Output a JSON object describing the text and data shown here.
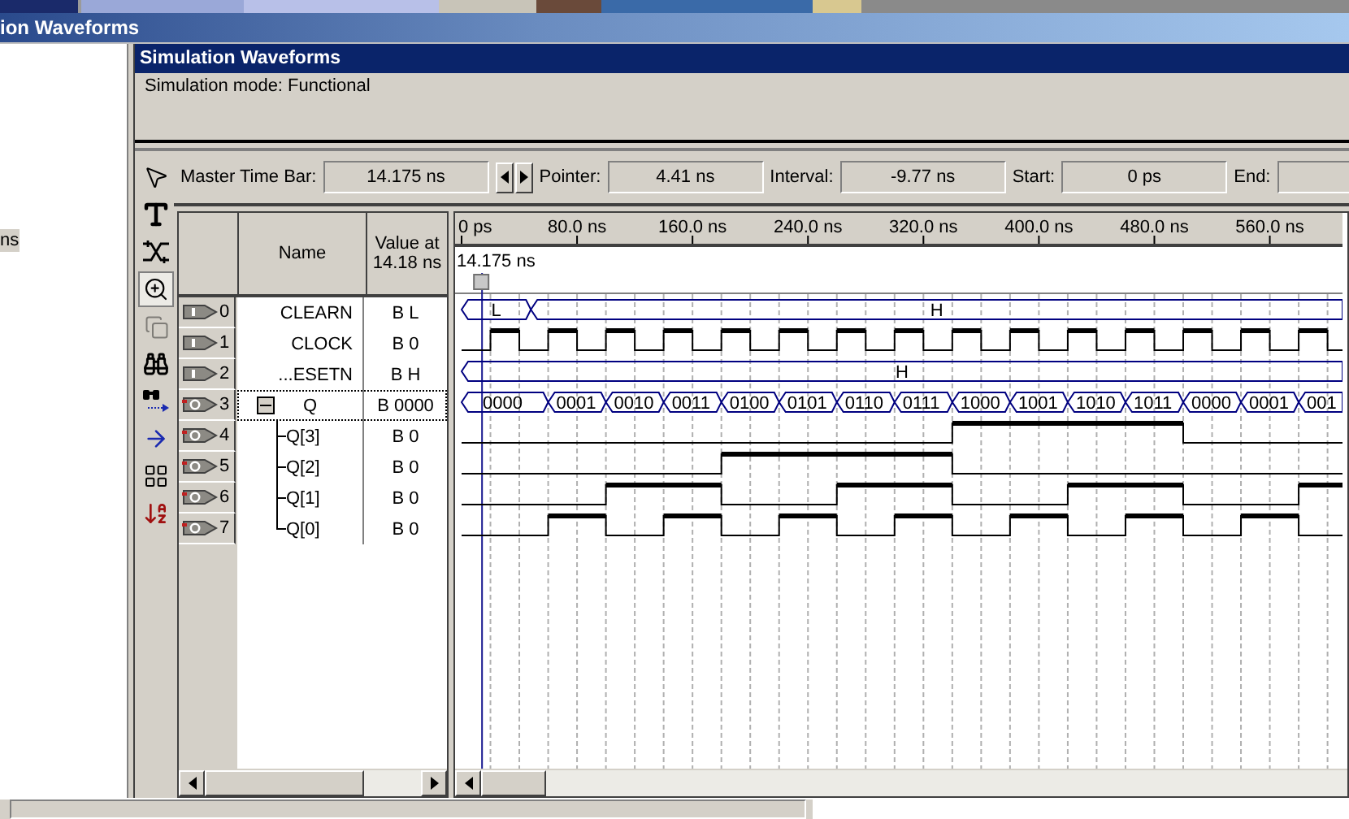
{
  "app_title": "ion Waveforms",
  "left_panel": {
    "fragment": "ns"
  },
  "window": {
    "title": "Simulation Waveforms",
    "mode": "Simulation mode: Functional"
  },
  "time_bar": {
    "master_label": "Master Time Bar:",
    "master_value": "14.175 ns",
    "pointer_label": "Pointer:",
    "pointer_value": "4.41 ns",
    "interval_label": "Interval:",
    "interval_value": "-9.77 ns",
    "start_label": "Start:",
    "start_value": "0 ps",
    "end_label": "End:"
  },
  "tools": [
    {
      "kind": "pointer",
      "selected": false,
      "disabled": false
    },
    {
      "kind": "text",
      "selected": false,
      "disabled": false
    },
    {
      "kind": "waveform-edit",
      "selected": false,
      "disabled": false
    },
    {
      "kind": "zoom",
      "selected": true,
      "disabled": false
    },
    {
      "kind": "copy",
      "selected": false,
      "disabled": true
    },
    {
      "kind": "find",
      "selected": false,
      "disabled": false
    },
    {
      "kind": "find-next",
      "selected": false,
      "disabled": false
    },
    {
      "kind": "arrow",
      "selected": false,
      "disabled": false
    },
    {
      "kind": "grid",
      "selected": false,
      "disabled": false
    },
    {
      "kind": "sort",
      "selected": false,
      "disabled": false
    }
  ],
  "columns": {
    "name": "Name",
    "value": "Value at 14.18 ns"
  },
  "signals": [
    {
      "index": "0",
      "name": "CLEARN",
      "value": "B L",
      "output": false,
      "kind": "level",
      "segments": [
        "L",
        "H"
      ],
      "selected": false
    },
    {
      "index": "1",
      "name": "CLOCK",
      "value": "B 0",
      "output": false,
      "kind": "clock",
      "selected": false
    },
    {
      "index": "2",
      "name": "...ESETN",
      "value": "B H",
      "output": false,
      "kind": "level",
      "segments": [
        "H"
      ],
      "selected": false
    },
    {
      "index": "3",
      "name": "Q",
      "value": "B 0000",
      "output": true,
      "kind": "bus",
      "expanded": true,
      "selected": true,
      "segments": [
        "0000",
        "0001",
        "0010",
        "0011",
        "0100",
        "0101",
        "0110",
        "0111",
        "1000",
        "1001",
        "1010",
        "1011",
        "0000",
        "0001",
        "001"
      ],
      "children": [
        {
          "index": "4",
          "name": "Q[3]",
          "value": "B 0",
          "output": true,
          "kind": "bit",
          "selected": false
        },
        {
          "index": "5",
          "name": "Q[2]",
          "value": "B 0",
          "output": true,
          "kind": "bit",
          "selected": false
        },
        {
          "index": "6",
          "name": "Q[1]",
          "value": "B 0",
          "output": true,
          "kind": "bit",
          "selected": false
        },
        {
          "index": "7",
          "name": "Q[0]",
          "value": "B 0",
          "output": true,
          "kind": "bit",
          "selected": false
        }
      ]
    }
  ],
  "ruler": {
    "ticks": [
      "0 ps",
      "80.0 ns",
      "160.0 ns",
      "240.0 ns",
      "320.0 ns",
      "400.0 ns",
      "480.0 ns",
      "560.0 ns"
    ],
    "cursor_label": "14.175 ns"
  }
}
